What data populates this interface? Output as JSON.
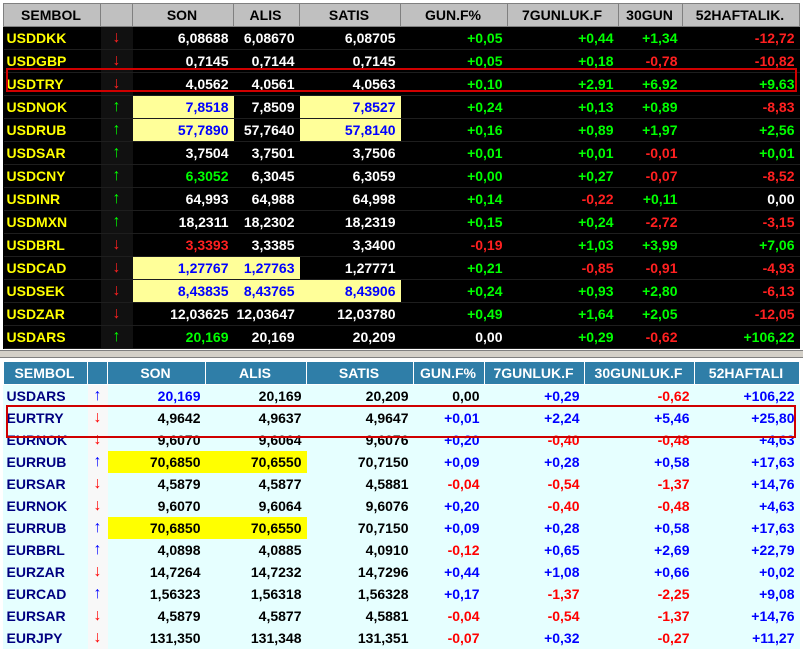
{
  "top_table": {
    "headers": [
      "SEMBOL",
      "",
      "SON",
      "ALIS",
      "SATIS",
      "GUN.F%",
      "7GUNLUK.F",
      "30GUN",
      "52HAFTALIK."
    ],
    "rows": [
      {
        "sym": "USDDKK",
        "dir": "down",
        "son": "6,08688",
        "alis": "6,08670",
        "satis": "6,08705",
        "d1": "+0,05",
        "d7": "+0,44",
        "d30": "+1,34",
        "d52": "-12,72"
      },
      {
        "sym": "USDGBP",
        "dir": "down",
        "son": "0,7145",
        "alis": "0,7144",
        "satis": "0,7145",
        "d1": "+0,05",
        "d7": "+0,18",
        "d30": "-0,78",
        "d52": "-10,82"
      },
      {
        "sym": "USDTRY",
        "dir": "down",
        "son": "4,0562",
        "alis": "4,0561",
        "satis": "4,0563",
        "d1": "+0,10",
        "d7": "+2,91",
        "d30": "+6,92",
        "d52": "+9,63"
      },
      {
        "sym": "USDNOK",
        "dir": "up",
        "son": "7,8518",
        "alis": "7,8509",
        "satis": "7,8527",
        "d1": "+0,24",
        "d7": "+0,13",
        "d30": "+0,89",
        "d52": "-8,83"
      },
      {
        "sym": "USDRUB",
        "dir": "up",
        "son": "57,7890",
        "alis": "57,7640",
        "satis": "57,8140",
        "d1": "+0,16",
        "d7": "+0,89",
        "d30": "+1,97",
        "d52": "+2,56"
      },
      {
        "sym": "USDSAR",
        "dir": "up",
        "son": "3,7504",
        "alis": "3,7501",
        "satis": "3,7506",
        "d1": "+0,01",
        "d7": "+0,01",
        "d30": "-0,01",
        "d52": "+0,01"
      },
      {
        "sym": "USDCNY",
        "dir": "up",
        "son": "6,3052",
        "alis": "6,3045",
        "satis": "6,3059",
        "d1": "+0,00",
        "d7": "+0,27",
        "d30": "-0,07",
        "d52": "-8,52"
      },
      {
        "sym": "USDINR",
        "dir": "up",
        "son": "64,993",
        "alis": "64,988",
        "satis": "64,998",
        "d1": "+0,14",
        "d7": "-0,22",
        "d30": "+0,11",
        "d52": "0,00"
      },
      {
        "sym": "USDMXN",
        "dir": "up",
        "son": "18,2311",
        "alis": "18,2302",
        "satis": "18,2319",
        "d1": "+0,15",
        "d7": "+0,24",
        "d30": "-2,72",
        "d52": "-3,15"
      },
      {
        "sym": "USDBRL",
        "dir": "down",
        "son": "3,3393",
        "alis": "3,3385",
        "satis": "3,3400",
        "d1": "-0,19",
        "d7": "+1,03",
        "d30": "+3,99",
        "d52": "+7,06"
      },
      {
        "sym": "USDCAD",
        "dir": "down",
        "son": "1,27767",
        "alis": "1,27763",
        "satis": "1,27771",
        "d1": "+0,21",
        "d7": "-0,85",
        "d30": "-0,91",
        "d52": "-4,93"
      },
      {
        "sym": "USDSEK",
        "dir": "down",
        "son": "8,43835",
        "alis": "8,43765",
        "satis": "8,43906",
        "d1": "+0,24",
        "d7": "+0,93",
        "d30": "+2,80",
        "d52": "-6,13"
      },
      {
        "sym": "USDZAR",
        "dir": "down",
        "son": "12,03625",
        "alis": "12,03647",
        "satis": "12,03780",
        "d1": "+0,49",
        "d7": "+1,64",
        "d30": "+2,05",
        "d52": "-12,05"
      },
      {
        "sym": "USDARS",
        "dir": "up",
        "son": "20,169",
        "alis": "20,169",
        "satis": "20,209",
        "d1": "0,00",
        "d7": "+0,29",
        "d30": "-0,62",
        "d52": "+106,22"
      }
    ]
  },
  "bottom_table": {
    "headers": [
      "SEMBOL",
      "",
      "SON",
      "ALIS",
      "SATIS",
      "GUN.F%",
      "7GUNLUK.F",
      "30GUNLUK.F",
      "52HAFTALI"
    ],
    "rows": [
      {
        "sym": "USDARS",
        "dir": "up",
        "son": "20,169",
        "alis": "20,169",
        "satis": "20,209",
        "d1": "0,00",
        "d7": "+0,29",
        "d30": "-0,62",
        "d52": "+106,22"
      },
      {
        "sym": "EURTRY",
        "dir": "down",
        "son": "4,9642",
        "alis": "4,9637",
        "satis": "4,9647",
        "d1": "+0,01",
        "d7": "+2,24",
        "d30": "+5,46",
        "d52": "+25,80"
      },
      {
        "sym": "EURNOK",
        "dir": "down",
        "son": "9,6070",
        "alis": "9,6064",
        "satis": "9,6076",
        "d1": "+0,20",
        "d7": "-0,40",
        "d30": "-0,48",
        "d52": "+4,63"
      },
      {
        "sym": "EURRUB",
        "dir": "up",
        "son": "70,6850",
        "alis": "70,6550",
        "satis": "70,7150",
        "d1": "+0,09",
        "d7": "+0,28",
        "d30": "+0,58",
        "d52": "+17,63"
      },
      {
        "sym": "EURSAR",
        "dir": "down",
        "son": "4,5879",
        "alis": "4,5877",
        "satis": "4,5881",
        "d1": "-0,04",
        "d7": "-0,54",
        "d30": "-1,37",
        "d52": "+14,76"
      },
      {
        "sym": "EURNOK",
        "dir": "down",
        "son": "9,6070",
        "alis": "9,6064",
        "satis": "9,6076",
        "d1": "+0,20",
        "d7": "-0,40",
        "d30": "-0,48",
        "d52": "+4,63"
      },
      {
        "sym": "EURRUB",
        "dir": "up",
        "son": "70,6850",
        "alis": "70,6550",
        "satis": "70,7150",
        "d1": "+0,09",
        "d7": "+0,28",
        "d30": "+0,58",
        "d52": "+17,63"
      },
      {
        "sym": "EURBRL",
        "dir": "up",
        "son": "4,0898",
        "alis": "4,0885",
        "satis": "4,0910",
        "d1": "-0,12",
        "d7": "+0,65",
        "d30": "+2,69",
        "d52": "+22,79"
      },
      {
        "sym": "EURZAR",
        "dir": "down",
        "son": "14,7264",
        "alis": "14,7232",
        "satis": "14,7296",
        "d1": "+0,44",
        "d7": "+1,08",
        "d30": "+0,66",
        "d52": "+0,02"
      },
      {
        "sym": "EURCAD",
        "dir": "up",
        "son": "1,56323",
        "alis": "1,56318",
        "satis": "1,56328",
        "d1": "+0,17",
        "d7": "-1,37",
        "d30": "-2,25",
        "d52": "+9,08"
      },
      {
        "sym": "EURSAR",
        "dir": "down",
        "son": "4,5879",
        "alis": "4,5877",
        "satis": "4,5881",
        "d1": "-0,04",
        "d7": "-0,54",
        "d30": "-1,37",
        "d52": "+14,76"
      },
      {
        "sym": "EURJPY",
        "dir": "down",
        "son": "131,350",
        "alis": "131,348",
        "satis": "131,351",
        "d1": "-0,07",
        "d7": "+0,32",
        "d30": "-0,27",
        "d52": "+11,27"
      }
    ]
  },
  "icons": {
    "up": "↑",
    "down": "↓"
  },
  "colors": {
    "highlight_yellow": "#ffff00",
    "highlight_pale": "#ffff99",
    "alert_box": "#d00000"
  }
}
